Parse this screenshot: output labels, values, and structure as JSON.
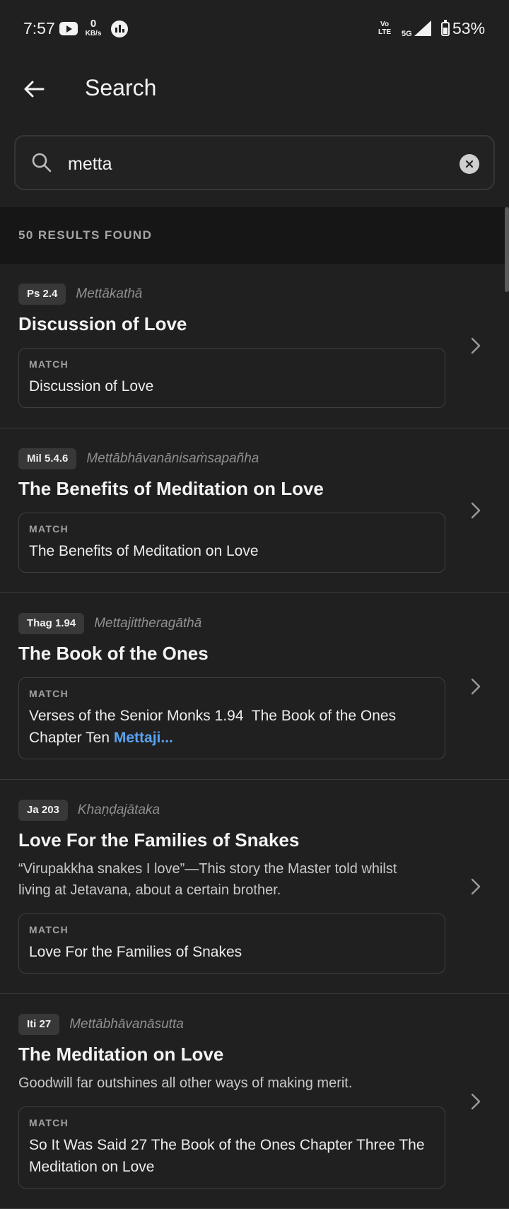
{
  "status_bar": {
    "time": "7:57",
    "net_speed_value": "0",
    "net_speed_unit": "KB/s",
    "volte_top": "Vo",
    "volte_bottom": "LTE",
    "network": "5G",
    "battery": "53%"
  },
  "app_bar": {
    "title": "Search"
  },
  "search": {
    "query": "metta"
  },
  "results_header": {
    "count_text": "50 RESULTS FOUND"
  },
  "results": [
    {
      "ref": "Ps 2.4",
      "pali": "Mettākathā",
      "title": "Discussion of Love",
      "description": "",
      "match_label": "MATCH",
      "match_text": "Discussion of Love",
      "match_highlight": ""
    },
    {
      "ref": "Mil 5.4.6",
      "pali": "Mettābhāvanānisaṁsapañha",
      "title": "The Benefits of Meditation on Love",
      "description": "",
      "match_label": "MATCH",
      "match_text": "The Benefits of Meditation on Love",
      "match_highlight": ""
    },
    {
      "ref": "Thag 1.94",
      "pali": "Mettajittheragāthā",
      "title": "The Book of the Ones",
      "description": "",
      "match_label": "MATCH",
      "match_text": "Verses of the Senior Monks 1.94  The Book of the Ones  Chapter Ten ",
      "match_highlight": "Mettaji..."
    },
    {
      "ref": "Ja 203",
      "pali": "Khaṇḍajātaka",
      "title": "Love For the Families of Snakes",
      "description": "“Virupakkha snakes I love”—This story the Master told whilst living at Jetavana, about a certain brother.",
      "match_label": "MATCH",
      "match_text": "Love For the Families of Snakes",
      "match_highlight": ""
    },
    {
      "ref": "Iti 27",
      "pali": "Mettābhāvanāsutta",
      "title": "The Meditation on Love",
      "description": "Goodwill far outshines all other ways of making merit.",
      "match_label": "MATCH",
      "match_text": "So It Was Said 27  The Book of the Ones  Chapter Three  The Meditation on Love",
      "match_highlight": ""
    }
  ]
}
